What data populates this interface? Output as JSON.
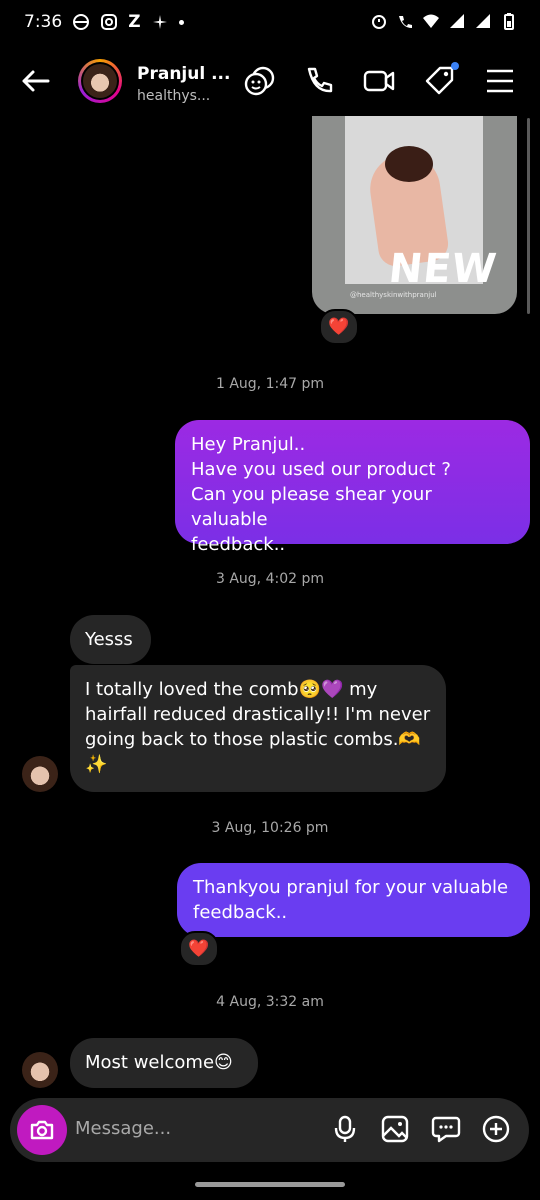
{
  "status": {
    "time": "7:36",
    "z": "Z"
  },
  "header": {
    "name": "Pranjul ...",
    "username": "healthys..."
  },
  "image_message": {
    "overlay_text": "NEW",
    "watermark": "@healthyskinwithpranjul",
    "reaction": "❤️"
  },
  "messages": [
    {
      "timestamp": "1 Aug, 1:47 pm"
    },
    {
      "sender": "me",
      "lines": [
        "Hey Pranjul..",
        "Have you used our product ?",
        "Can you please shear your valuable",
        "feedback.."
      ]
    },
    {
      "timestamp": "3 Aug, 4:02 pm"
    },
    {
      "sender": "them",
      "text": "Yesss"
    },
    {
      "sender": "them",
      "lines": [
        "I totally loved the comb🥺💜 my",
        "hairfall reduced drastically!! I'm never",
        "going back to those plastic combs.🫶",
        "✨"
      ]
    },
    {
      "timestamp": "3 Aug, 10:26 pm"
    },
    {
      "sender": "me",
      "lines": [
        "Thankyou pranjul for your valuable",
        "feedback.."
      ],
      "reaction": "❤️"
    },
    {
      "timestamp": "4 Aug, 3:32 am"
    },
    {
      "sender": "them",
      "text": "Most welcome😊"
    }
  ],
  "composer": {
    "placeholder": "Message..."
  }
}
